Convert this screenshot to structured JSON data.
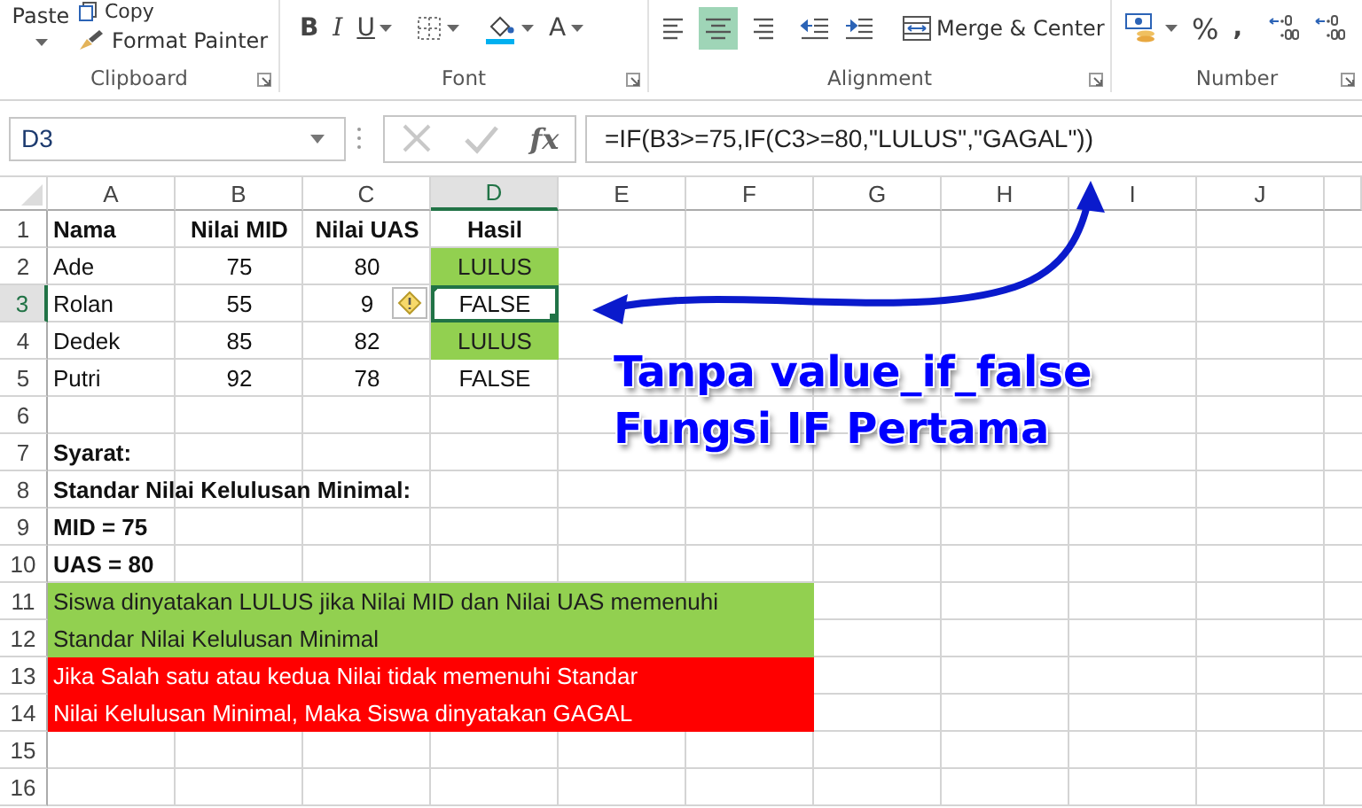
{
  "ribbon": {
    "groups": [
      {
        "label": "Clipboard",
        "buttons": [
          {
            "kind": "paste",
            "label": "Paste"
          },
          {
            "kind": "copy",
            "label": "Copy"
          },
          {
            "kind": "format-painter",
            "label": "Format Painter"
          }
        ]
      },
      {
        "label": "Font",
        "buttons": [
          {
            "kind": "bold",
            "label": "B"
          },
          {
            "kind": "italic",
            "label": "I"
          },
          {
            "kind": "underline",
            "label": "U"
          },
          {
            "kind": "borders"
          },
          {
            "kind": "fill-color"
          },
          {
            "kind": "font-color",
            "label": "A"
          }
        ]
      },
      {
        "label": "Alignment",
        "buttons": [
          {
            "kind": "align-left",
            "selected": false
          },
          {
            "kind": "align-center",
            "selected": true
          },
          {
            "kind": "align-right",
            "selected": false
          },
          {
            "kind": "outdent"
          },
          {
            "kind": "indent"
          },
          {
            "kind": "merge",
            "label": "Merge & Center"
          }
        ]
      },
      {
        "label": "Number",
        "buttons": [
          {
            "kind": "currency"
          },
          {
            "kind": "percent",
            "label": "%"
          },
          {
            "kind": "comma",
            "label": ","
          },
          {
            "kind": "increase-decimal"
          },
          {
            "kind": "decrease-decimal"
          }
        ]
      }
    ]
  },
  "formula_bar": {
    "name_box": "D3",
    "insert_function": "fx",
    "formula": "=IF(B3>=75,IF(C3>=80,\"LULUS\",\"GAGAL\"))"
  },
  "columns": [
    {
      "label": "A",
      "selected": false
    },
    {
      "label": "B",
      "selected": false
    },
    {
      "label": "C",
      "selected": false
    },
    {
      "label": "D",
      "selected": true
    },
    {
      "label": "E",
      "selected": false
    },
    {
      "label": "F",
      "selected": false
    },
    {
      "label": "G",
      "selected": false
    },
    {
      "label": "H",
      "selected": false
    },
    {
      "label": "I",
      "selected": false
    },
    {
      "label": "J",
      "selected": false
    }
  ],
  "rows": [
    {
      "number": "1",
      "selected": false,
      "kind": "header",
      "cells": [
        {
          "text": "Nama"
        },
        {
          "text": "Nilai MID"
        },
        {
          "text": "Nilai UAS"
        },
        {
          "text": "Hasil"
        }
      ]
    },
    {
      "number": "2",
      "selected": false,
      "kind": "data",
      "cells": [
        {
          "text": "Ade"
        },
        {
          "text": "75"
        },
        {
          "text": "80"
        },
        {
          "text": "LULUS",
          "color": "#92d050"
        }
      ]
    },
    {
      "number": "3",
      "selected": true,
      "kind": "data",
      "cells": [
        {
          "text": "Rolan"
        },
        {
          "text": "55"
        },
        {
          "text": "9",
          "warning": true
        },
        {
          "text": "FALSE"
        }
      ]
    },
    {
      "number": "4",
      "selected": false,
      "kind": "data",
      "cells": [
        {
          "text": "Dedek"
        },
        {
          "text": "85"
        },
        {
          "text": "82"
        },
        {
          "text": "LULUS",
          "color": "#92d050"
        }
      ]
    },
    {
      "number": "5",
      "selected": false,
      "kind": "data",
      "cells": [
        {
          "text": "Putri"
        },
        {
          "text": "92"
        },
        {
          "text": "78"
        },
        {
          "text": "FALSE"
        }
      ]
    },
    {
      "number": "6",
      "selected": false,
      "kind": "data",
      "cells": []
    },
    {
      "number": "7",
      "selected": false,
      "kind": "note",
      "cells": [
        {
          "text": "Syarat:"
        }
      ]
    },
    {
      "number": "8",
      "selected": false,
      "kind": "note",
      "cells": [
        {
          "text": "Standar Nilai Kelulusan Minimal:"
        }
      ]
    },
    {
      "number": "9",
      "selected": false,
      "kind": "note",
      "cells": [
        {
          "text": "MID = 75"
        }
      ]
    },
    {
      "number": "10",
      "selected": false,
      "kind": "note",
      "cells": [
        {
          "text": "UAS = 80"
        }
      ]
    },
    {
      "number": "11",
      "selected": false,
      "kind": "band",
      "cells": [
        {
          "text": "Siswa dinyatakan LULUS jika Nilai MID dan Nilai UAS memenuhi",
          "color": "#92d050"
        },
        {
          "color": "#92d050"
        },
        {
          "color": "#92d050"
        },
        {
          "color": "#92d050"
        },
        {
          "color": "#92d050"
        },
        {
          "color": "#92d050"
        }
      ]
    },
    {
      "number": "12",
      "selected": false,
      "kind": "band",
      "cells": [
        {
          "text": "Standar Nilai Kelulusan Minimal",
          "color": "#92d050"
        },
        {
          "color": "#92d050"
        },
        {
          "color": "#92d050"
        },
        {
          "color": "#92d050"
        },
        {
          "color": "#92d050"
        },
        {
          "color": "#92d050"
        }
      ]
    },
    {
      "number": "13",
      "selected": false,
      "kind": "band",
      "cells": [
        {
          "text": "Jika Salah satu atau kedua Nilai tidak memenuhi Standar",
          "color": "#ff0000"
        },
        {
          "color": "#ff0000"
        },
        {
          "color": "#ff0000"
        },
        {
          "color": "#ff0000"
        },
        {
          "color": "#ff0000"
        },
        {
          "color": "#ff0000"
        }
      ]
    },
    {
      "number": "14",
      "selected": false,
      "kind": "band",
      "cells": [
        {
          "text": "Nilai Kelulusan Minimal, Maka Siswa dinyatakan GAGAL",
          "color": "#ff0000"
        },
        {
          "color": "#ff0000"
        },
        {
          "color": "#ff0000"
        },
        {
          "color": "#ff0000"
        },
        {
          "color": "#ff0000"
        },
        {
          "color": "#ff0000"
        }
      ]
    },
    {
      "number": "15",
      "selected": false,
      "kind": "data",
      "cells": []
    },
    {
      "number": "16",
      "selected": false,
      "kind": "data",
      "cells": []
    }
  ],
  "annotation": {
    "lines": [
      "Tanpa value_if_false",
      "Fungsi IF Pertama"
    ]
  }
}
